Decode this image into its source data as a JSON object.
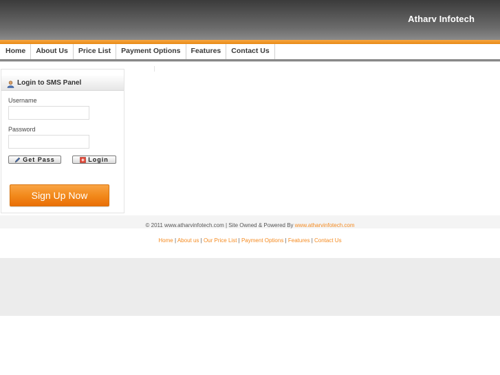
{
  "header": {
    "brand": "Atharv Infotech"
  },
  "nav": {
    "items": [
      {
        "label": "Home"
      },
      {
        "label": "About Us"
      },
      {
        "label": "Price List"
      },
      {
        "label": "Payment Options"
      },
      {
        "label": "Features"
      },
      {
        "label": "Contact Us"
      }
    ]
  },
  "login_panel": {
    "title": "Login to SMS Panel",
    "username_label": "Username",
    "username_value": "",
    "password_label": "Password",
    "password_value": "",
    "get_pass_label": "Get Pass",
    "login_label": "Login",
    "signup_label": "Sign Up Now"
  },
  "footer": {
    "copyright_text": "© 2011 www.atharvinfotech.com | Site Owned & Powered By",
    "powered_link": "www.atharvinfotech.com",
    "links": [
      {
        "label": "Home"
      },
      {
        "label": "About us"
      },
      {
        "label": "Our Price List"
      },
      {
        "label": "Payment Options"
      },
      {
        "label": "Features"
      },
      {
        "label": "Contact Us"
      }
    ],
    "separator": "|"
  },
  "colors": {
    "accent": "#f58a1f",
    "header_dark": "#3b3b3b",
    "nav_rule": "#888888"
  },
  "icons": [
    "user-icon",
    "pencil-icon",
    "close-icon"
  ]
}
